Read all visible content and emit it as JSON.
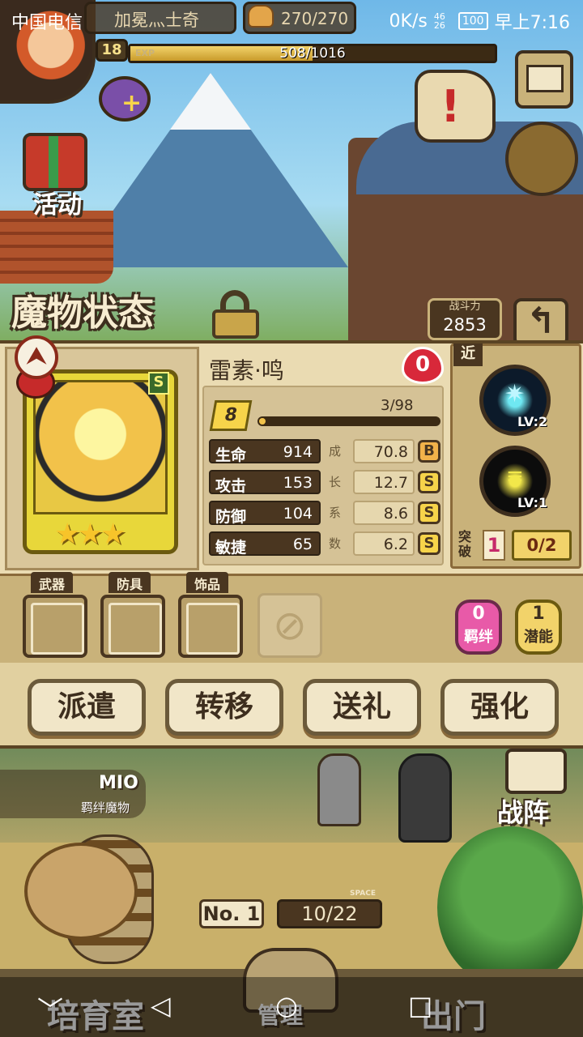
{
  "status_bar": {
    "carrier": "中国电信",
    "net_speed": "0K/s",
    "signal": "46 26",
    "battery": "100",
    "time": "早上7:16"
  },
  "player": {
    "name": "加冕灬士奇",
    "level": "18",
    "exp_label": "EXP",
    "exp_text": "508/1016",
    "exp_fraction": 0.5,
    "food": "270/270"
  },
  "hud": {
    "activity_label": "活动"
  },
  "monster_screen": {
    "title": "魔物状态",
    "power_label": "战斗力",
    "power_value": "2853",
    "back_icon": "back-arrow-icon"
  },
  "monster": {
    "name": "雷素·鸣",
    "grade_tag": "S",
    "stars": "★★★",
    "heart_count": "0",
    "level": "8",
    "level_progress": "3/98",
    "level_fraction": 0.03,
    "stats": [
      {
        "name": "生命",
        "value": "914",
        "growth_char": "成",
        "growth": "70.8",
        "grade": "B"
      },
      {
        "name": "攻击",
        "value": "153",
        "growth_char": "长",
        "growth": "12.7",
        "grade": "S"
      },
      {
        "name": "防御",
        "value": "104",
        "growth_char": "系",
        "growth": "8.6",
        "grade": "S"
      },
      {
        "name": "敏捷",
        "value": "65",
        "growth_char": "数",
        "growth": "6.2",
        "grade": "S"
      }
    ]
  },
  "skills": {
    "range_tag": "近",
    "items": [
      {
        "icon": "lightning-burst-icon",
        "level": "LV:2"
      },
      {
        "icon": "yellow-slash-icon",
        "level": "LV:1"
      }
    ],
    "break_label": "突破",
    "break_level": "1",
    "break_count": "0/2"
  },
  "equipment": {
    "slots": [
      "武器",
      "防具",
      "饰品"
    ],
    "bond_count": "0",
    "bond_label": "羁绊",
    "potential_count": "1",
    "potential_label": "潜能"
  },
  "actions": [
    "派遣",
    "转移",
    "送礼",
    "强化"
  ],
  "lower": {
    "mio_name": "MIO",
    "mio_sub": "羁绊魔物",
    "team_label": "战阵",
    "no_label": "No. 1",
    "space_tag": "SPACE",
    "capacity": "10/22"
  },
  "bottom_nav": [
    "培育室",
    "管理",
    "出门"
  ],
  "android_nav": [
    "﹀",
    "◁",
    "○",
    "□"
  ]
}
